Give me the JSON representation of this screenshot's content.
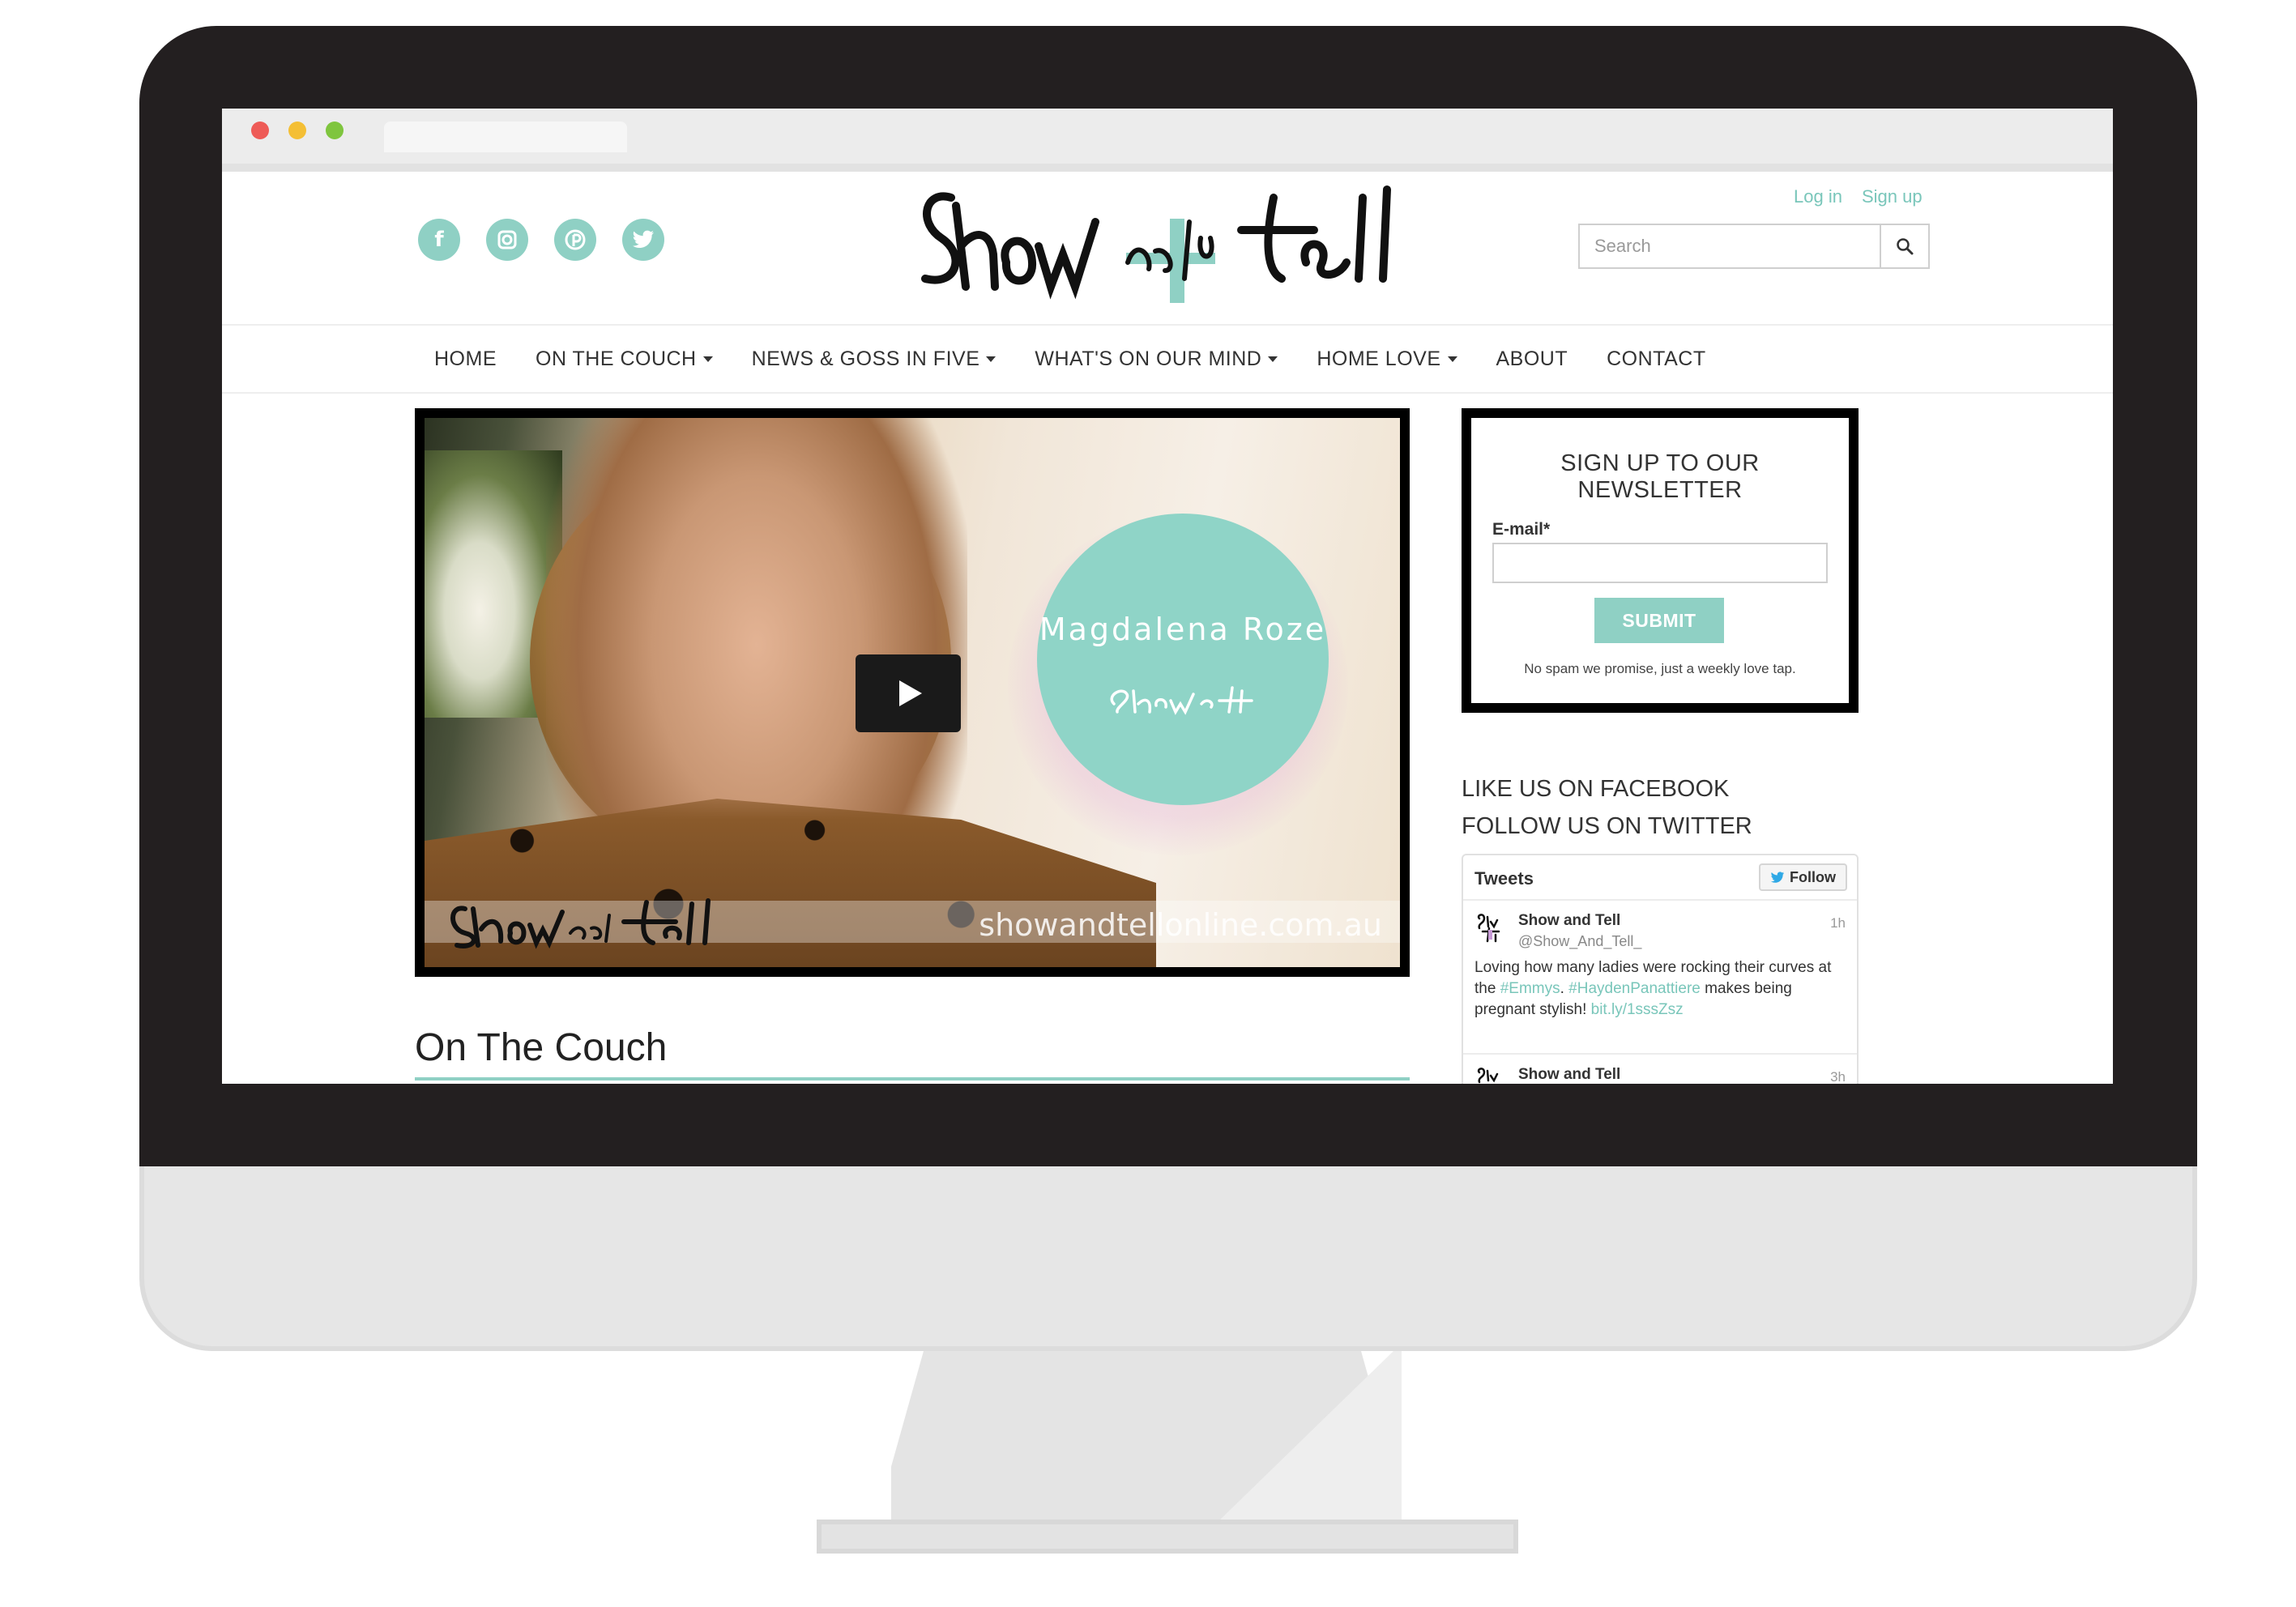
{
  "site": {
    "logo_text": "Show and Tell",
    "social": [
      {
        "name": "facebook",
        "glyph": "f"
      },
      {
        "name": "instagram",
        "glyph": "◙"
      },
      {
        "name": "pinterest",
        "glyph": "P"
      },
      {
        "name": "twitter",
        "glyph": "t"
      }
    ],
    "auth": {
      "login": "Log in",
      "signup": "Sign up"
    },
    "search": {
      "placeholder": "Search"
    }
  },
  "nav": {
    "items": [
      {
        "label": "HOME",
        "dropdown": false
      },
      {
        "label": "ON THE COUCH",
        "dropdown": true
      },
      {
        "label": "NEWS & GOSS IN FIVE",
        "dropdown": true
      },
      {
        "label": "WHAT'S ON OUR MIND",
        "dropdown": true
      },
      {
        "label": "HOME LOVE",
        "dropdown": true
      },
      {
        "label": "ABOUT",
        "dropdown": false
      },
      {
        "label": "CONTACT",
        "dropdown": false
      }
    ]
  },
  "video": {
    "badge_name": "Magdalena Roze",
    "watermark_url": "showandtellonline.com.au"
  },
  "main": {
    "section_title": "On The Couch"
  },
  "newsletter": {
    "title_line1": "SIGN UP TO OUR",
    "title_line2": "NEWSLETTER",
    "email_label": "E-mail*",
    "submit_label": "SUBMIT",
    "note": "No spam we promise, just a weekly love tap."
  },
  "sidebar": {
    "like_heading": "LIKE US ON FACEBOOK",
    "follow_heading": "FOLLOW US ON TWITTER"
  },
  "twitter": {
    "title": "Tweets",
    "follow_label": "Follow",
    "tweets": [
      {
        "name": "Show and Tell",
        "handle": "@Show_And_Tell_",
        "time": "1h",
        "text_1": "Loving how many ladies were rocking their curves at the ",
        "tag_1": "#Emmys",
        "text_2": ". ",
        "tag_2": "#HaydenPanattiere",
        "text_3": " makes being pregnant stylish! ",
        "link": "bit.ly/1sssZsz"
      },
      {
        "name": "Show and Tell",
        "time": "3h"
      }
    ]
  },
  "colors": {
    "accent": "#8fd0c4",
    "link": "#79c6ba",
    "frame": "#231f20"
  }
}
